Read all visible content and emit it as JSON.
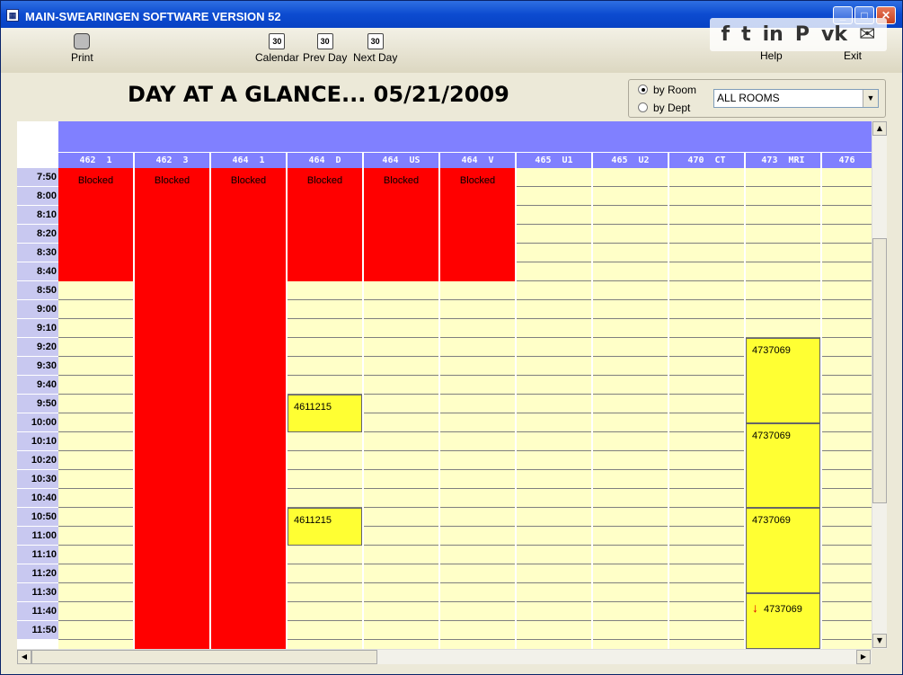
{
  "window": {
    "title": "MAIN-SWEARINGEN SOFTWARE VERSION 52"
  },
  "toolbar": {
    "print": "Print",
    "calendar": "Calendar",
    "prev_day": "Prev Day",
    "next_day": "Next Day",
    "help": "Help",
    "exit": "Exit",
    "calendar_icon_text": "30"
  },
  "share_icons": [
    "f",
    "t",
    "in",
    "P",
    "vk",
    "✉"
  ],
  "page": {
    "title": "DAY AT A GLANCE... 05/21/2009"
  },
  "view_mode": {
    "by_room": "by Room",
    "by_dept": "by Dept",
    "selected": "by Room"
  },
  "room_select": {
    "value": "ALL ROOMS"
  },
  "rooms": [
    "462  1",
    "462  3",
    "464  1",
    "464  D",
    "464  US",
    "464  V",
    "465  U1",
    "465  U2",
    "470  CT",
    "473  MRI",
    "476"
  ],
  "times": [
    "7:50",
    "8:00",
    "8:10",
    "8:20",
    "8:30",
    "8:40",
    "8:50",
    "9:00",
    "9:10",
    "9:20",
    "9:30",
    "9:40",
    "9:50",
    "10:00",
    "10:10",
    "10:20",
    "10:30",
    "10:40",
    "10:50",
    "11:00",
    "11:10",
    "11:20",
    "11:30",
    "11:40",
    "11:50"
  ],
  "blocked_label": "Blocked",
  "blocks": [
    {
      "room": 0,
      "start": 0,
      "slots": 6,
      "label": "Blocked"
    },
    {
      "room": 1,
      "start": 0,
      "slots": 26,
      "label": "Blocked"
    },
    {
      "room": 2,
      "start": 0,
      "slots": 26,
      "label": "Blocked"
    },
    {
      "room": 3,
      "start": 0,
      "slots": 6,
      "label": "Blocked"
    },
    {
      "room": 4,
      "start": 0,
      "slots": 6,
      "label": "Blocked"
    },
    {
      "room": 5,
      "start": 0,
      "slots": 6,
      "label": "Blocked"
    }
  ],
  "appointments": [
    {
      "room": 3,
      "start": 12,
      "slots": 2,
      "label": "4611215",
      "arrow": false
    },
    {
      "room": 3,
      "start": 18,
      "slots": 2,
      "label": "4611215",
      "arrow": false
    },
    {
      "room": 9,
      "start": 9,
      "slots": 4.5,
      "label": "4737069",
      "arrow": false
    },
    {
      "room": 9,
      "start": 13.5,
      "slots": 4.5,
      "label": "4737069",
      "arrow": false
    },
    {
      "room": 9,
      "start": 18,
      "slots": 4.5,
      "label": "4737069",
      "arrow": false
    },
    {
      "room": 9,
      "start": 22.5,
      "slots": 3,
      "label": "4737069",
      "arrow": true
    }
  ]
}
